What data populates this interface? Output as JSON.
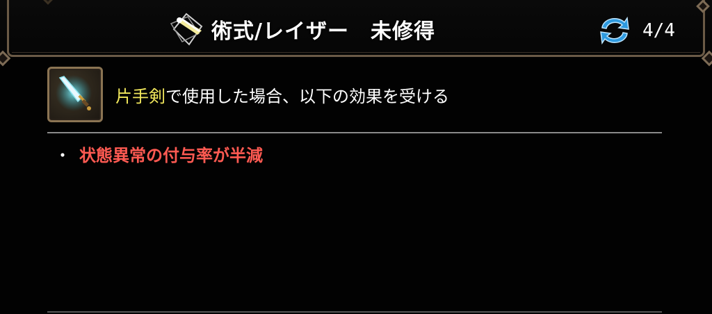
{
  "header": {
    "skill_icon": "light-beam-icon",
    "title": "術式/レイザー　未修得",
    "cycle_icon": "cycle-arrows-icon",
    "page": "4/4"
  },
  "body": {
    "weapon_icon": "sword-icon",
    "weapon_name": "片手剣",
    "description_suffix": "で使用した場合、以下の効果を受ける",
    "bullet": "・",
    "effects": [
      "状態異常の付与率が半減"
    ]
  },
  "colors": {
    "weapon_name": "#f2e85c",
    "effect_text": "#ff5a52",
    "frame": "#6b5a46",
    "cycle_icon": "#2f9be0"
  }
}
